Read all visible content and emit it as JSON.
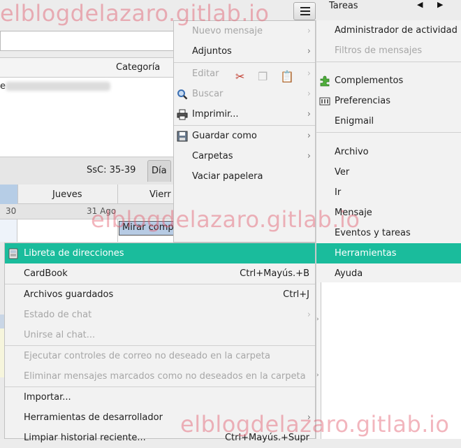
{
  "header": {
    "tasks_label": "Tareas",
    "prev_arrow": "◀",
    "next_arrow": "▶",
    "menu_icon": "hamburger-menu-icon"
  },
  "message_list": {
    "category_header": "Categoría",
    "row_prefix": "e"
  },
  "calendar": {
    "week_label": "SsC: 35-39",
    "day_tab": "Día",
    "day_headers": [
      "Jueves",
      "Vierr"
    ],
    "dates": [
      "30",
      "31 Ago"
    ],
    "event_title": "Mirar comp"
  },
  "app_menu": {
    "left_items": [
      {
        "label": "Nuevo mensaje",
        "disabled": true,
        "submenu": true,
        "icon": ""
      },
      {
        "label": "Adjuntos",
        "disabled": false,
        "submenu": true,
        "icon": ""
      },
      {
        "label": "Editar",
        "disabled": true,
        "submenu": true,
        "icon": ""
      },
      {
        "label": "Buscar",
        "disabled": true,
        "submenu": true,
        "icon": "search-icon"
      },
      {
        "label": "Imprimir...",
        "disabled": false,
        "submenu": true,
        "icon": "printer-icon"
      },
      {
        "label": "Guardar como",
        "disabled": false,
        "submenu": true,
        "icon": "save-icon"
      },
      {
        "label": "Carpetas",
        "disabled": false,
        "submenu": true,
        "icon": ""
      },
      {
        "label": "Vaciar papelera",
        "disabled": false,
        "submenu": false,
        "icon": ""
      }
    ],
    "edit_icons": [
      "cut-icon",
      "copy-icon",
      "paste-icon"
    ],
    "right_items": [
      {
        "label": "Administrador de actividad",
        "disabled": false,
        "icon": ""
      },
      {
        "label": "Filtros de mensajes",
        "disabled": true,
        "icon": ""
      },
      {
        "label": "Complementos",
        "disabled": false,
        "icon": "puzzle-icon"
      },
      {
        "label": "Preferencias",
        "disabled": false,
        "icon": "preferences-icon"
      },
      {
        "label": "Enigmail",
        "disabled": false,
        "icon": ""
      },
      {
        "label": "Archivo",
        "disabled": false,
        "icon": ""
      },
      {
        "label": "Ver",
        "disabled": false,
        "icon": ""
      },
      {
        "label": "Ir",
        "disabled": false,
        "icon": ""
      },
      {
        "label": "Mensaje",
        "disabled": false,
        "icon": ""
      },
      {
        "label": "Eventos y tareas",
        "disabled": false,
        "icon": ""
      },
      {
        "label": "Herramientas",
        "disabled": false,
        "highlighted": true,
        "icon": ""
      },
      {
        "label": "Ayuda",
        "disabled": false,
        "icon": ""
      }
    ]
  },
  "tools_menu": {
    "items": [
      {
        "label": "Libreta de direcciones",
        "shortcut": "",
        "disabled": false,
        "highlighted": true,
        "icon": "address-book-icon"
      },
      {
        "label": "CardBook",
        "shortcut": "Ctrl+Mayús.+B",
        "disabled": false
      },
      {
        "label": "Archivos guardados",
        "shortcut": "Ctrl+J",
        "disabled": false
      },
      {
        "label": "Estado de chat",
        "shortcut": "",
        "disabled": true,
        "submenu": true
      },
      {
        "label": "Unirse al chat...",
        "shortcut": "",
        "disabled": true
      },
      {
        "label": "Ejecutar controles de correo no deseado en la carpeta",
        "shortcut": "",
        "disabled": true
      },
      {
        "label": "Eliminar mensajes marcados como no deseados en la carpeta",
        "shortcut": "",
        "disabled": true
      },
      {
        "label": "Importar...",
        "shortcut": "",
        "disabled": false
      },
      {
        "label": "Herramientas de desarrollador",
        "shortcut": "",
        "disabled": false,
        "submenu": true
      },
      {
        "label": "Limpiar historial reciente...",
        "shortcut": "Ctrl+Mayús.+Supr",
        "disabled": false
      }
    ]
  },
  "watermark": "elblogdelazaro.gitlab.io",
  "colors": {
    "highlight": "#1abc9c",
    "watermark": "#e25c6c",
    "disabled_text": "#a6a6a6"
  }
}
